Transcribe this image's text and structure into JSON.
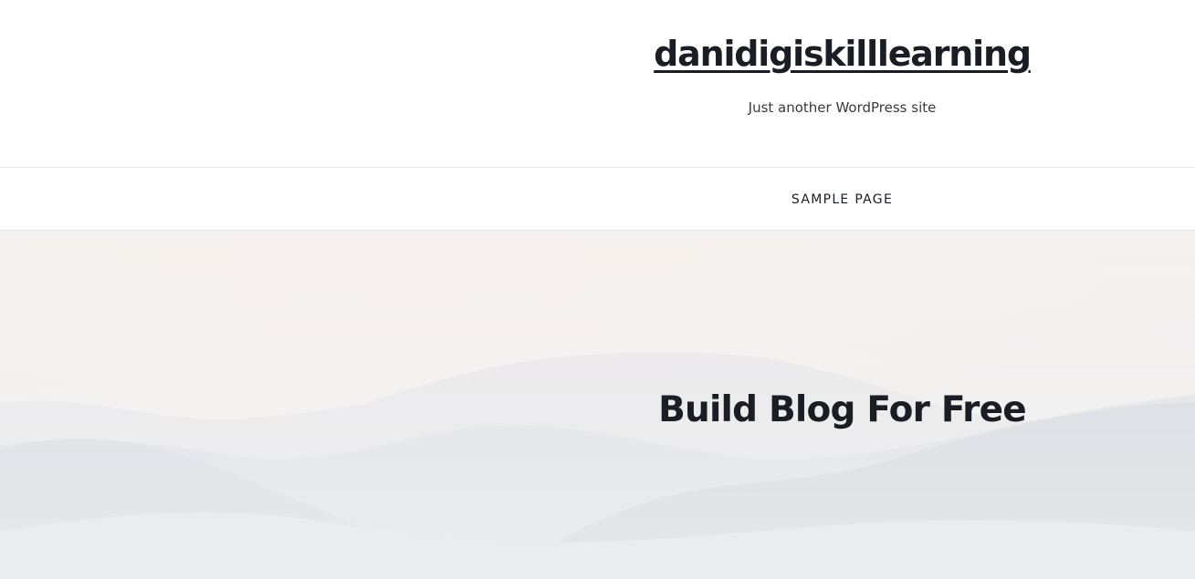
{
  "site": {
    "title": "danidigiskilllearning",
    "tagline": "Just another WordPress site"
  },
  "nav": {
    "items": [
      {
        "label": "SAMPLE PAGE"
      }
    ]
  },
  "hero": {
    "heading": "Build Blog For Free"
  }
}
